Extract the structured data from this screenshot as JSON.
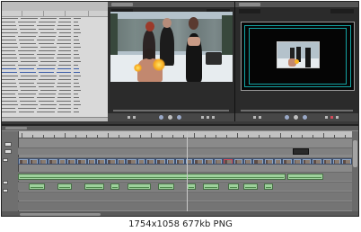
{
  "caption": "1754x1058 677kb PNG",
  "colors": {
    "timeline_bg": "#8a8a8a",
    "video_clip": "#8fa7c8",
    "audio_clip": "#9ed19c",
    "safe_area": "#13a3a3",
    "selection_row": "#3d5fa8",
    "marker_red": "#d24b5a"
  },
  "icons": [
    "play-icon",
    "step-back-icon",
    "step-forward-icon",
    "loop-icon"
  ]
}
